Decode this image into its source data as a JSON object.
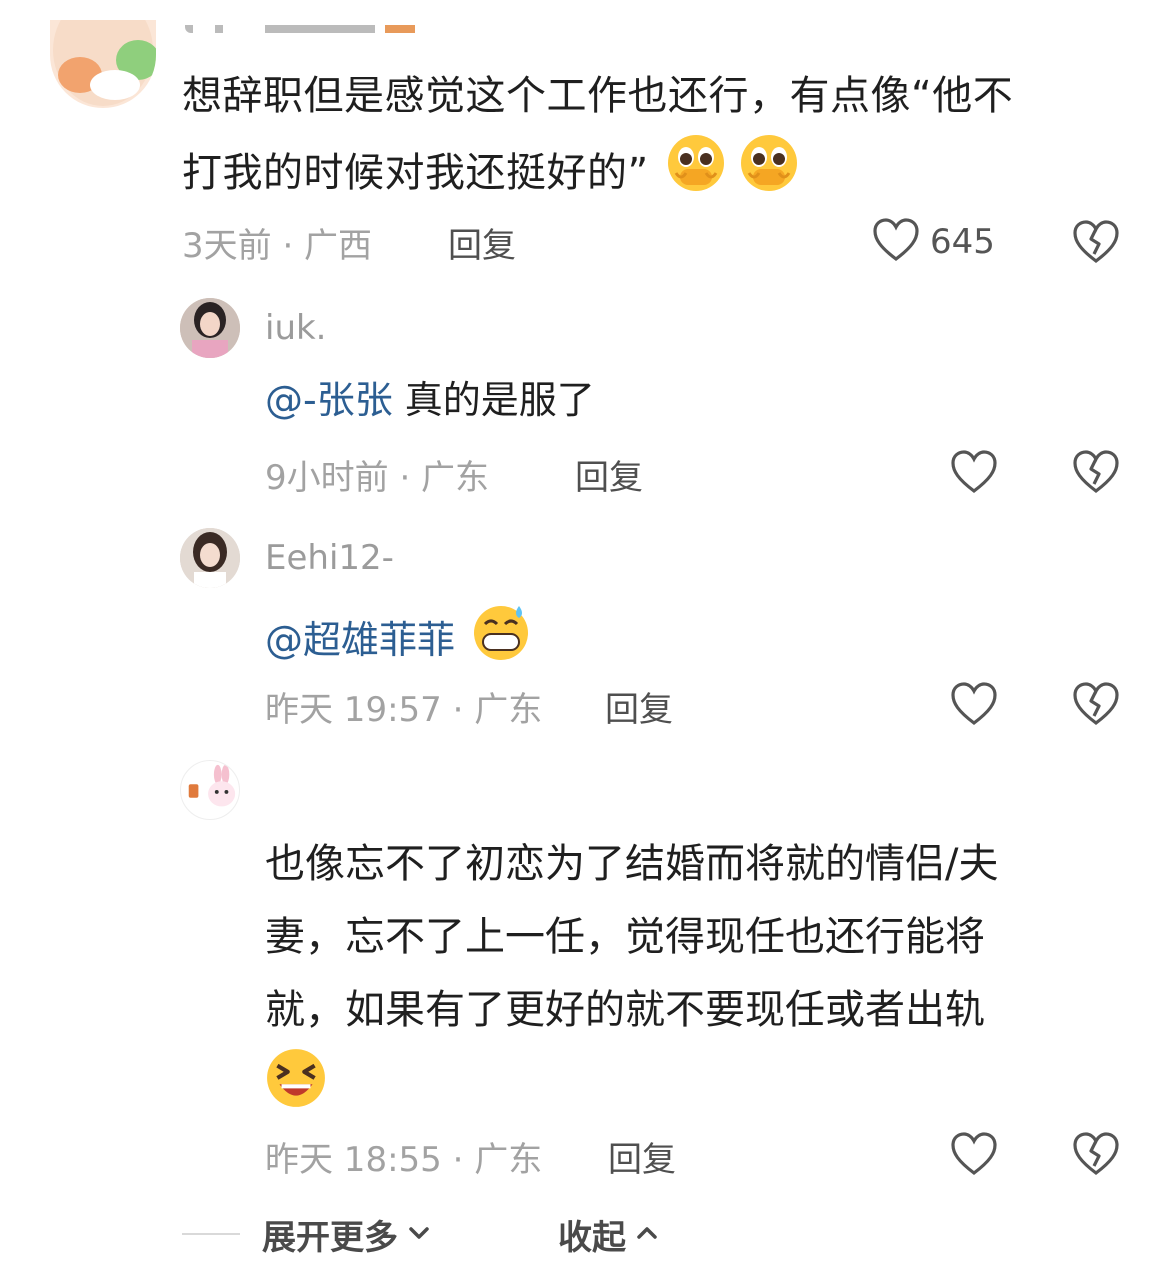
{
  "top_comment": {
    "text_line1": "想辞职但是感觉这个工作也还行，有点像“他不",
    "text_line2": "打我的时候对我还挺好的”",
    "emojis": [
      "pleading-face-icon",
      "pleading-face-icon"
    ],
    "meta": "3天前 · 广西",
    "reply_label": "回复",
    "like_count": "645"
  },
  "replies": [
    {
      "username": "iuk.",
      "mention": "@-张张",
      "text": " 真的是服了",
      "meta": "9小时前 · 广东",
      "reply_label": "回复"
    },
    {
      "username": "Eehi12-",
      "mention": "@超雄菲菲",
      "text": "",
      "emoji": "grinning-sweat-icon",
      "meta": "昨天 19:57 · 广东",
      "reply_label": "回复"
    },
    {
      "username": "",
      "lines": [
        "也像忘不了初恋为了结婚而将就的情侣/夫",
        "妻，忘不了上一任，觉得现任也还行能将",
        "就，如果有了更好的就不要现任或者出轨"
      ],
      "emoji": "laughing-squint-icon",
      "meta": "昨天 18:55 · 广东",
      "reply_label": "回复"
    }
  ],
  "footer": {
    "expand_label": "展开更多",
    "collapse_label": "收起"
  },
  "colors": {
    "mention": "#2c5e92",
    "meta": "#a2a2a2"
  }
}
